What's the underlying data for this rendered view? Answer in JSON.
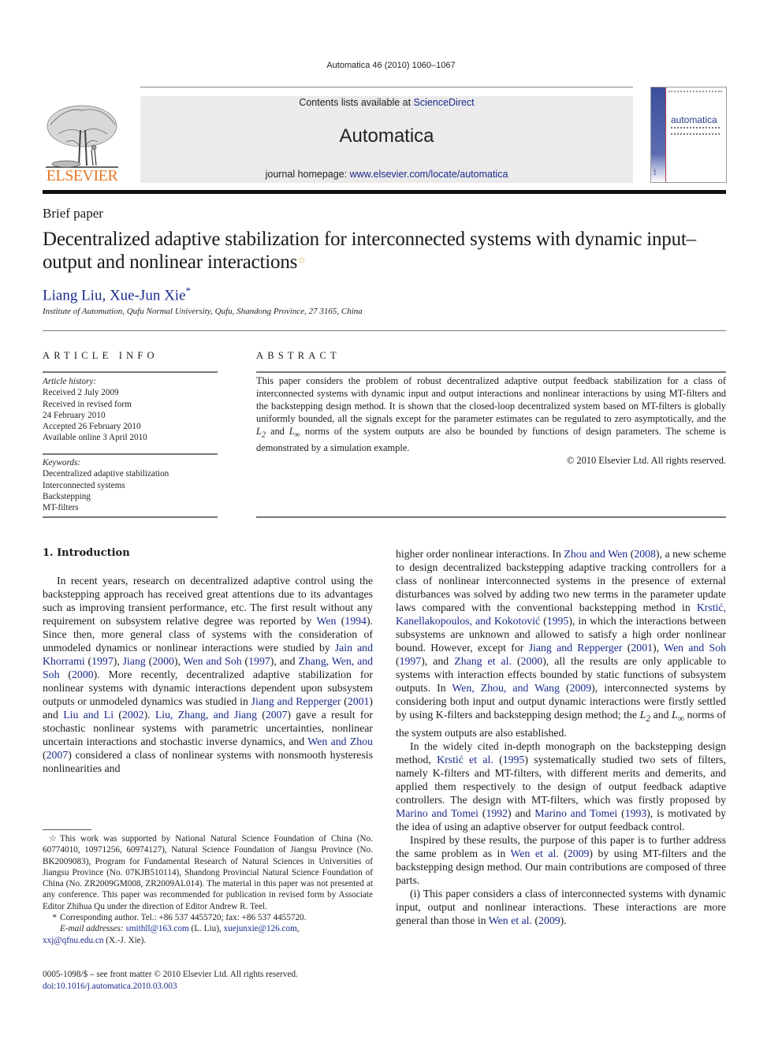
{
  "header": {
    "journal_ref": "Automatica 46 (2010) 1060–1067",
    "contents_prefix": "Contents lists available at ",
    "contents_link": "ScienceDirect",
    "journal_name": "Automatica",
    "homepage_prefix": "journal homepage: ",
    "homepage_link": "www.elsevier.com/locate/automatica",
    "publisher_logo_text": "ELSEVIER",
    "publisher_logo_icon": "elsevier-tree-icon",
    "cover_title": "automatica",
    "cover_ifac": "IFAC"
  },
  "article": {
    "section_type": "Brief paper",
    "title": "Decentralized adaptive stabilization for interconnected systems with dynamic input–output and nonlinear interactions",
    "title_mark": "☆",
    "authors": [
      {
        "name": "Liang Liu",
        "mark": ""
      },
      {
        "name": "Xue-Jun Xie",
        "mark": "*"
      }
    ],
    "author_separator": ", ",
    "affiliation": "Institute of Automation, Qufu Normal University, Qufu, Shandong Province, 27 3165, China"
  },
  "article_info": {
    "heading": "ARTICLE INFO",
    "history_label": "Article history:",
    "history": [
      "Received 2 July 2009",
      "Received in revised form",
      "24 February 2010",
      "Accepted 26 February 2010",
      "Available online 3 April 2010"
    ],
    "keywords_label": "Keywords:",
    "keywords": [
      "Decentralized adaptive stabilization",
      "Interconnected systems",
      "Backstepping",
      "MT-filters"
    ]
  },
  "abstract": {
    "heading": "ABSTRACT",
    "text_1": "This paper considers the problem of robust decentralized adaptive output feedback stabilization for a class of interconnected systems with dynamic input and output interactions and nonlinear interactions by using MT-filters and the backstepping design method. It is shown that the closed-loop decentralized system based on MT-filters is globally uniformly bounded, all the signals except for the parameter estimates can be regulated to zero asymptotically, and the ",
    "l2": "L",
    "l2_sub": "2",
    "and": " and ",
    "linf": "L",
    "linf_sub": "∞",
    "text_2": " norms of the system outputs are also be bounded by functions of design parameters. The scheme is demonstrated by a simulation example.",
    "copyright": "© 2010 Elsevier Ltd. All rights reserved."
  },
  "introduction": {
    "heading": "1.  Introduction",
    "left_para": [
      {
        "t": "In recent years, research on decentralized adaptive control using the backstepping approach has received great attentions due to its advantages such as improving transient performance, etc. The first result without any requirement on subsystem relative degree was reported by "
      },
      {
        "link": "Wen"
      },
      {
        "t": " ("
      },
      {
        "link": "1994"
      },
      {
        "t": "). Since then, more general class of systems with the consideration of unmodeled dynamics or nonlinear interactions were studied by "
      },
      {
        "link": "Jain and Khorrami"
      },
      {
        "t": " ("
      },
      {
        "link": "1997"
      },
      {
        "t": "), "
      },
      {
        "link": "Jiang"
      },
      {
        "t": " ("
      },
      {
        "link": "2000"
      },
      {
        "t": "), "
      },
      {
        "link": "Wen and Soh"
      },
      {
        "t": " ("
      },
      {
        "link": "1997"
      },
      {
        "t": "), and "
      },
      {
        "link": "Zhang, Wen, and Soh"
      },
      {
        "t": " ("
      },
      {
        "link": "2000"
      },
      {
        "t": "). More recently, decentralized adaptive stabilization for nonlinear systems with dynamic interactions dependent upon subsystem outputs or unmodeled dynamics was studied in "
      },
      {
        "link": "Jiang and Repperger"
      },
      {
        "t": " ("
      },
      {
        "link": "2001"
      },
      {
        "t": ") and "
      },
      {
        "link": "Liu and Li"
      },
      {
        "t": " ("
      },
      {
        "link": "2002"
      },
      {
        "t": "). "
      },
      {
        "link": "Liu, Zhang, and Jiang"
      },
      {
        "t": " ("
      },
      {
        "link": "2007"
      },
      {
        "t": ") gave a result for stochastic nonlinear systems with parametric uncertainties, nonlinear uncertain interactions and stochastic inverse dynamics, and "
      },
      {
        "link": "Wen and Zhou"
      },
      {
        "t": " ("
      },
      {
        "link": "2007"
      },
      {
        "t": ") considered a class of nonlinear systems with nonsmooth hysteresis nonlinearities and"
      }
    ],
    "right_para_1": [
      {
        "t": "higher order nonlinear interactions. In "
      },
      {
        "link": "Zhou and Wen"
      },
      {
        "t": " ("
      },
      {
        "link": "2008"
      },
      {
        "t": "), a new scheme to design decentralized backstepping adaptive tracking controllers for a class of nonlinear interconnected systems in the presence of external disturbances was solved by adding two new terms in the parameter update laws compared with the conventional backstepping method in "
      },
      {
        "link": "Krstić, Kanellakopoulos, and Kokotović"
      },
      {
        "t": " ("
      },
      {
        "link": "1995"
      },
      {
        "t": "), in which the interactions between subsystems are unknown and allowed to satisfy a high order nonlinear bound. However, except for "
      },
      {
        "link": "Jiang and Repperger"
      },
      {
        "t": " ("
      },
      {
        "link": "2001"
      },
      {
        "t": "), "
      },
      {
        "link": "Wen and Soh"
      },
      {
        "t": " ("
      },
      {
        "link": "1997"
      },
      {
        "t": "), and "
      },
      {
        "link": "Zhang et al."
      },
      {
        "t": " ("
      },
      {
        "link": "2000"
      },
      {
        "t": "), all the results are only applicable to systems with interaction effects bounded by static functions of subsystem outputs. In "
      },
      {
        "link": "Wen, Zhou, and Wang"
      },
      {
        "t": " ("
      },
      {
        "link": "2009"
      },
      {
        "t": "), interconnected systems by considering both input and output dynamic interactions were firstly settled by using K-filters and backstepping design method; the "
      },
      {
        "math": "L",
        "sub": "2"
      },
      {
        "t": " and "
      },
      {
        "math": "L",
        "sub": "∞"
      },
      {
        "t": " norms of the system outputs are also established."
      }
    ],
    "right_para_2": [
      {
        "t": "In the widely cited in-depth monograph on the backstepping design method, "
      },
      {
        "link": "Krstić et al."
      },
      {
        "t": " ("
      },
      {
        "link": "1995"
      },
      {
        "t": ") systematically studied two sets of filters, namely K-filters and MT-filters, with different merits and demerits, and applied them respectively to the design of output feedback adaptive controllers. The design with MT-filters, which was firstly proposed by "
      },
      {
        "link": "Marino and Tomei"
      },
      {
        "t": " ("
      },
      {
        "link": "1992"
      },
      {
        "t": ") and "
      },
      {
        "link": "Marino and Tomei"
      },
      {
        "t": " ("
      },
      {
        "link": "1993"
      },
      {
        "t": "), is motivated by the idea of using an adaptive observer for output feedback control."
      }
    ],
    "right_para_3": [
      {
        "t": "Inspired by these results, the purpose of this paper is to further address the same problem as in "
      },
      {
        "link": "Wen et al."
      },
      {
        "t": " ("
      },
      {
        "link": "2009"
      },
      {
        "t": ") by using MT-filters and the backstepping design method. Our main contributions are composed of three parts."
      }
    ],
    "right_para_4": [
      {
        "t": "(i) This paper considers a class of interconnected systems with dynamic input, output and nonlinear interactions. These interactions are more general than those in "
      },
      {
        "link": "Wen et al."
      },
      {
        "t": " ("
      },
      {
        "link": "2009"
      },
      {
        "t": ")."
      }
    ]
  },
  "footnotes": {
    "funding_mark": "☆",
    "funding": "This work was supported by National Natural Science Foundation of China (No. 60774010, 10971256, 60974127), Natural Science Foundation of Jiangsu Province (No. BK2009083), Program for Fundamental Research of Natural Sciences in Universities of Jiangsu Province (No. 07KJB510114), Shandong Provincial Natural Science Foundation of China (No. ZR2009GM008, ZR2009AL014). The material in this paper was not presented at any conference. This paper was recommended for publication in revised form by Associate Editor Zhihua Qu under the direction of Editor Andrew R. Teel.",
    "corresponding_mark": "*",
    "corresponding": "Corresponding author. Tel.: +86 537 4455720; fax: +86 537 4455720.",
    "email_label": "E-mail addresses:",
    "email_1": "smithll@163.com",
    "email_1_owner": " (L. Liu), ",
    "email_2": "xuejunxie@126.com",
    "email_2_sep": ",",
    "email_3": "xxj@qfnu.edu.cn",
    "email_3_owner": " (X.-J. Xie)."
  },
  "front_matter": {
    "issn_line": "0005-1098/$ – see front matter © 2010 Elsevier Ltd. All rights reserved.",
    "doi": "doi:10.1016/j.automatica.2010.03.003"
  }
}
